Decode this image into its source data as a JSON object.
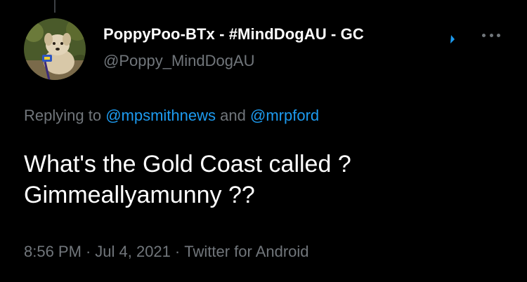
{
  "tweet": {
    "author": {
      "display_name": "PoppyPoo-BTx - #MindDogAU - GC",
      "handle": "@Poppy_MindDogAU",
      "avatar": "dog-avatar-icon"
    },
    "reply": {
      "prefix": "Replying to",
      "mention_1": "@mpsmithnews",
      "conjunction": "and",
      "mention_2": "@mrpford"
    },
    "text_lines": [
      "What's the Gold Coast called ?",
      "Gimmeallyamunny ??"
    ],
    "meta": {
      "time": "8:56 PM",
      "separator": "·",
      "date": "Jul 4, 2021",
      "source": "Twitter for Android"
    }
  },
  "colors": {
    "background": "#000000",
    "primary_text": "#ffffff",
    "secondary_text": "#71767b",
    "link": "#1d9bf0"
  }
}
